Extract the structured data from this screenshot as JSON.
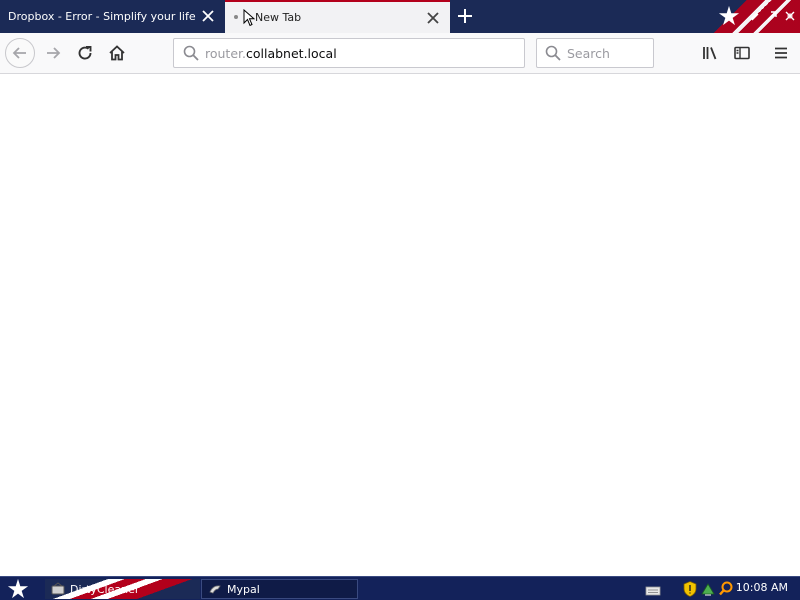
{
  "browser": {
    "tabs": [
      {
        "title": "Dropbox - Error - Simplify your life",
        "active": false
      },
      {
        "title": "New Tab",
        "active": true
      }
    ],
    "url": {
      "prefix": "router.",
      "host": "collabnet.local"
    },
    "search_placeholder": "Search"
  },
  "taskbar": {
    "tasks": [
      {
        "label": "DirtyCleaner",
        "icon": "cleaner-icon"
      },
      {
        "label": "Mypal",
        "icon": "mypal-icon"
      }
    ],
    "clock": "10:08 AM"
  },
  "colors": {
    "tabstrip": "#1b2a56",
    "active_tab_accent": "#b3001b",
    "taskbar": "#13225a"
  }
}
